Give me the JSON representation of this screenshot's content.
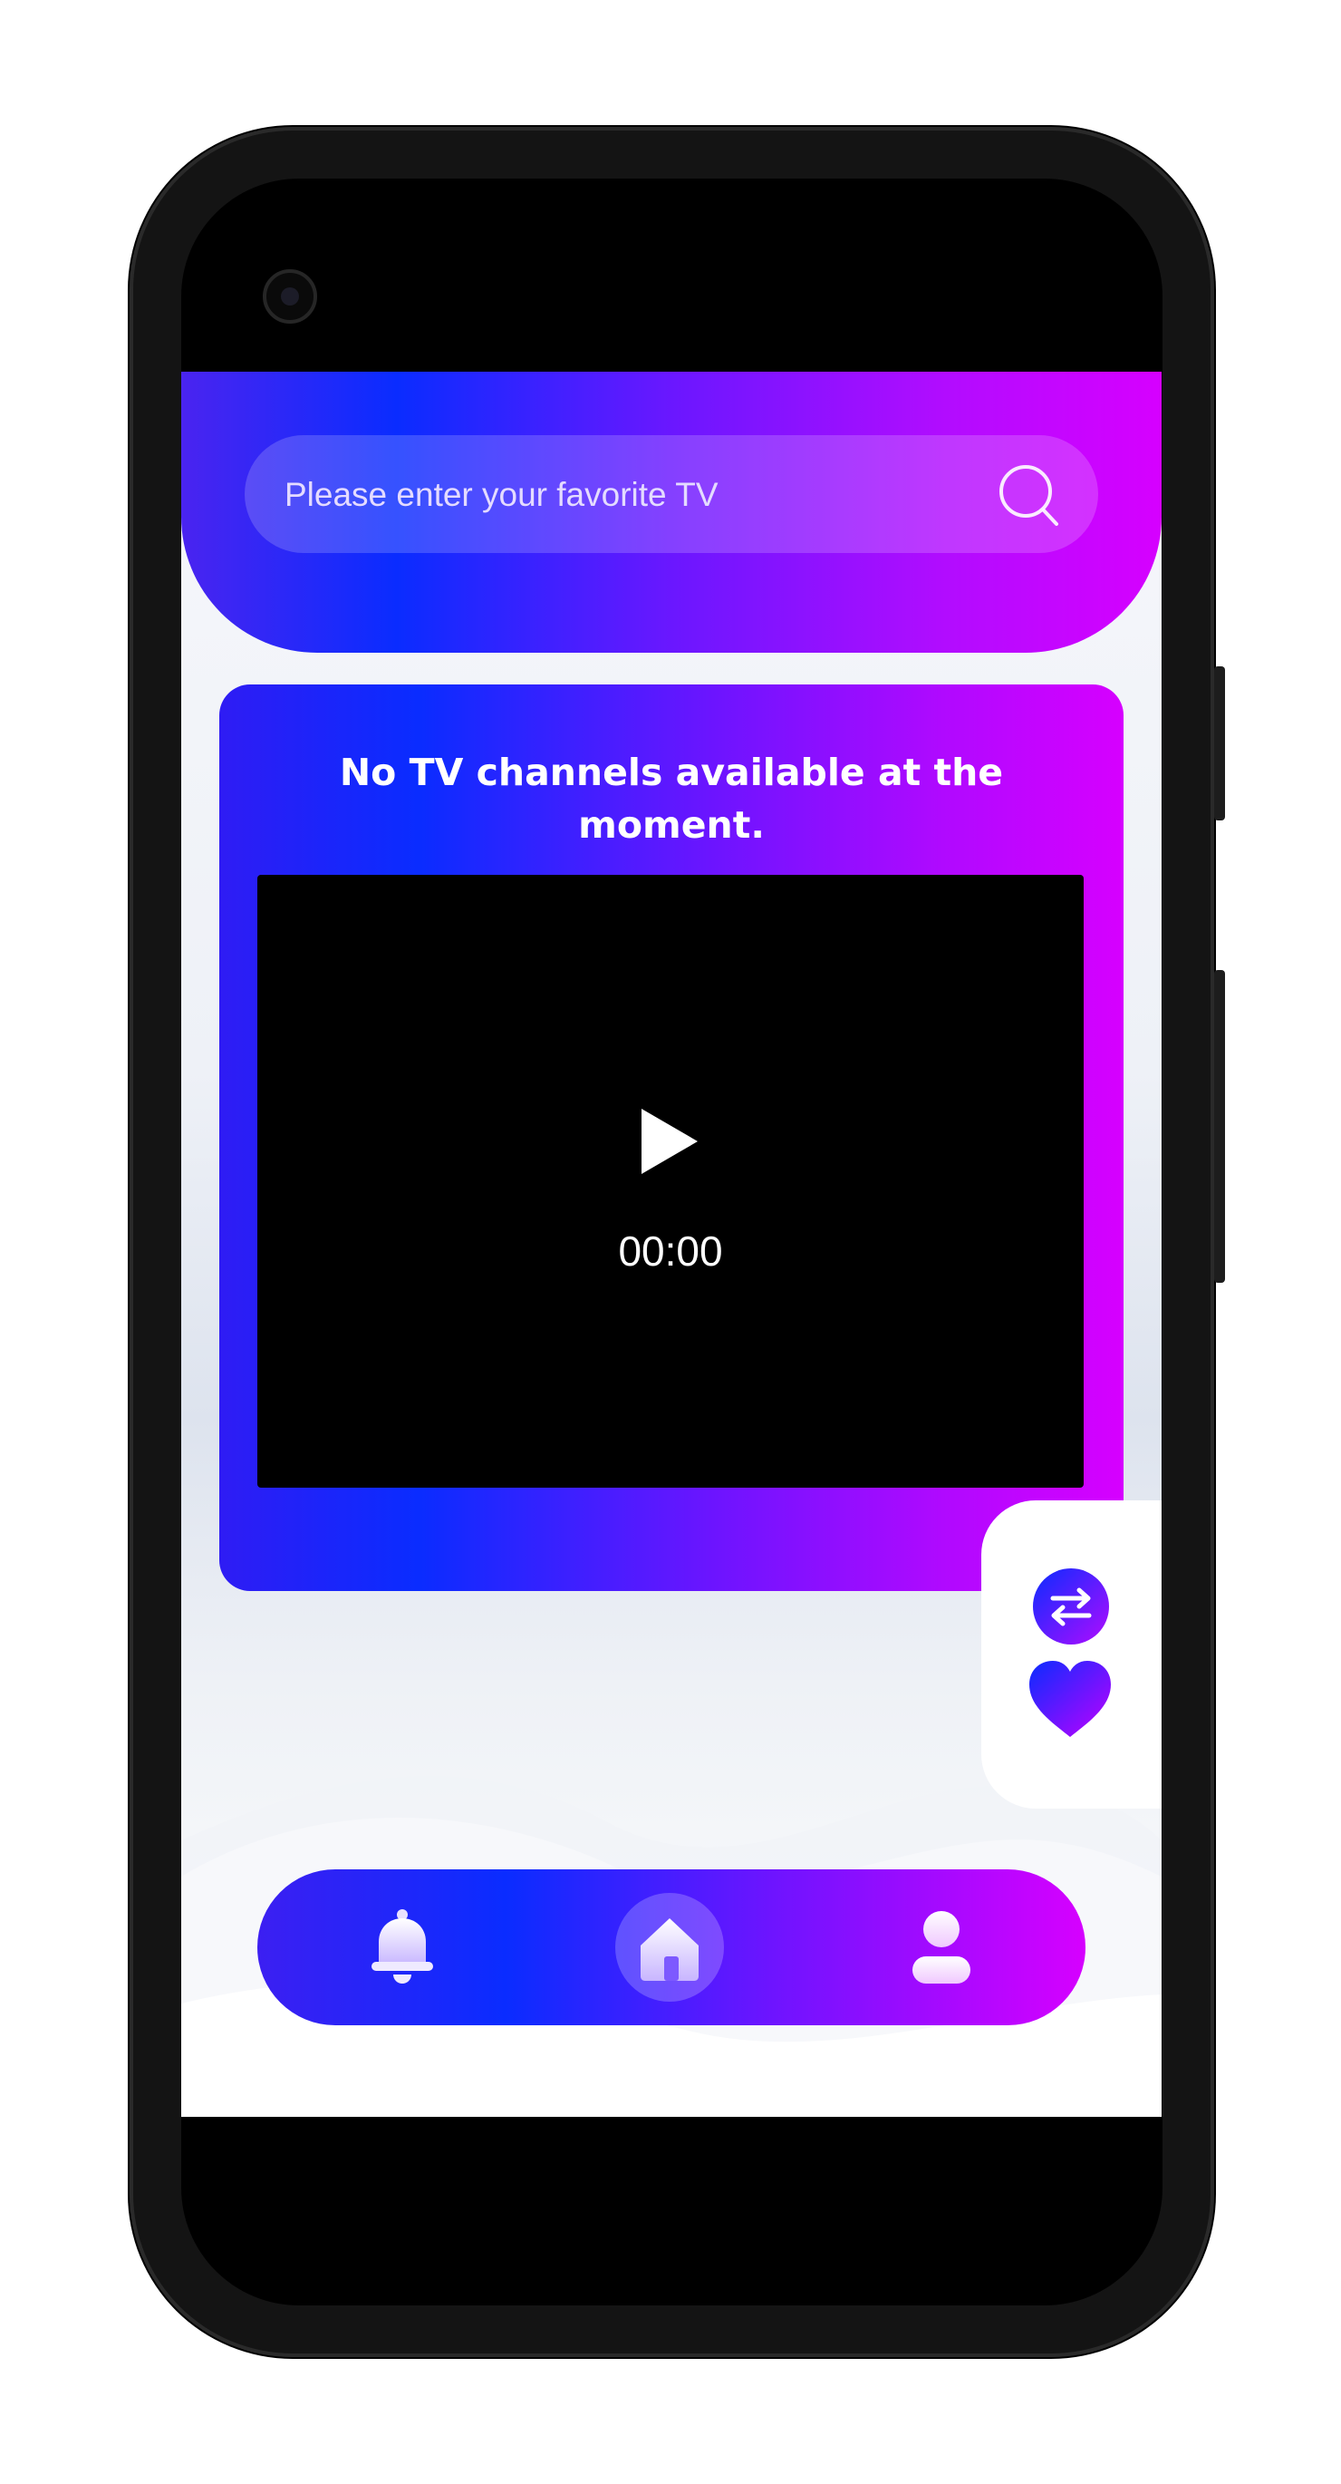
{
  "search": {
    "placeholder": "Please enter your favorite TV"
  },
  "player": {
    "message": "No TV channels available at the moment.",
    "time": "00:00"
  },
  "icons": {
    "search": "search-icon",
    "play": "play-icon",
    "swap": "swap-icon",
    "favorite": "heart-icon",
    "nav_bell": "bell-icon",
    "nav_home": "home-icon",
    "nav_user": "user-icon"
  },
  "colors": {
    "gradient_start": "#0a2cff",
    "gradient_mid": "#6d14ff",
    "gradient_end": "#d600ff"
  }
}
